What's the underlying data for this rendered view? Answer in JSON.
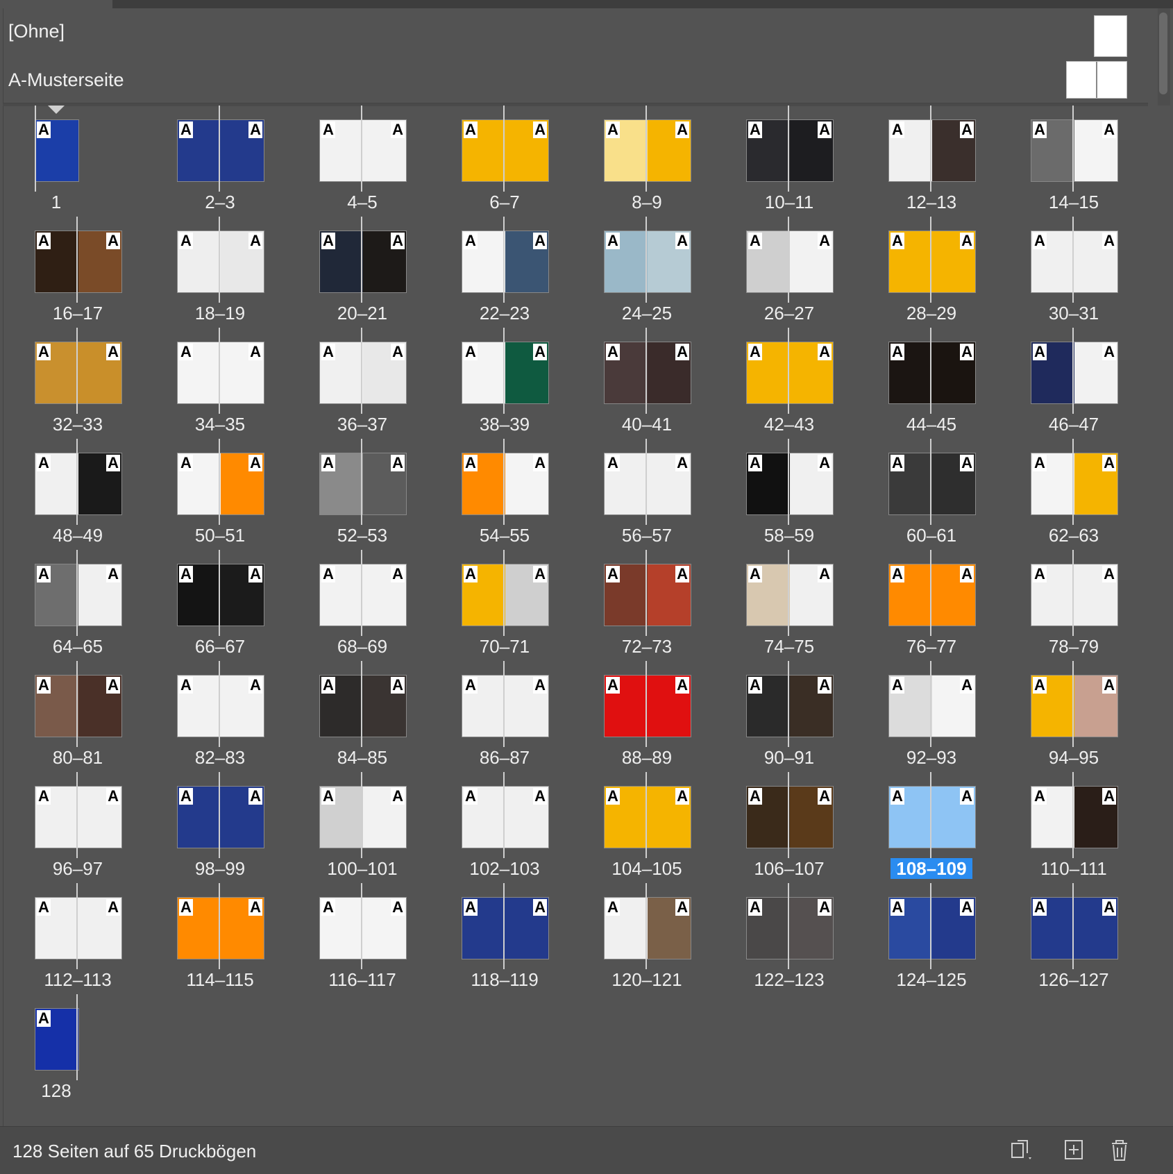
{
  "masters": {
    "none_label": "[Ohne]",
    "a_master_label": "A-Musterseite"
  },
  "spreads": [
    {
      "label": "1",
      "pages": 1,
      "colors": [
        "#1b3ea8"
      ],
      "marks": [
        "A"
      ]
    },
    {
      "label": "2–3",
      "pages": 2,
      "colors": [
        "#233a8c",
        "#233a8c"
      ],
      "marks": [
        "A",
        "A"
      ]
    },
    {
      "label": "4–5",
      "pages": 2,
      "colors": [
        "#f2f2f2",
        "#f2f2f2"
      ],
      "marks": [
        "A",
        "A"
      ]
    },
    {
      "label": "6–7",
      "pages": 2,
      "colors": [
        "#f5b400",
        "#f5b400"
      ],
      "marks": [
        "A",
        "A"
      ]
    },
    {
      "label": "8–9",
      "pages": 2,
      "colors": [
        "#f9e08a",
        "#f5b400"
      ],
      "marks": [
        "A",
        "A"
      ]
    },
    {
      "label": "10–11",
      "pages": 2,
      "colors": [
        "#2a2a2e",
        "#1d1d20"
      ],
      "marks": [
        "A",
        "A"
      ]
    },
    {
      "label": "12–13",
      "pages": 2,
      "colors": [
        "#f0f0f0",
        "#3a2f2c"
      ],
      "marks": [
        "A",
        "A"
      ]
    },
    {
      "label": "14–15",
      "pages": 2,
      "colors": [
        "#6b6b6b",
        "#f4f4f4"
      ],
      "marks": [
        "A",
        "A"
      ]
    },
    {
      "label": "16–17",
      "pages": 2,
      "colors": [
        "#2f1f14",
        "#7a4b28"
      ],
      "marks": [
        "A",
        "A"
      ]
    },
    {
      "label": "18–19",
      "pages": 2,
      "colors": [
        "#eeeeee",
        "#e8e8e8"
      ],
      "marks": [
        "A",
        "A"
      ]
    },
    {
      "label": "20–21",
      "pages": 2,
      "colors": [
        "#202838",
        "#1d1a18"
      ],
      "marks": [
        "A",
        "A"
      ]
    },
    {
      "label": "22–23",
      "pages": 2,
      "colors": [
        "#f4f4f4",
        "#3b5573"
      ],
      "marks": [
        "A",
        "A"
      ]
    },
    {
      "label": "24–25",
      "pages": 2,
      "colors": [
        "#9ab8c8",
        "#b6cbd4"
      ],
      "marks": [
        "A",
        "A"
      ]
    },
    {
      "label": "26–27",
      "pages": 2,
      "colors": [
        "#cfcfcf",
        "#f2f2f2"
      ],
      "marks": [
        "A",
        "A"
      ]
    },
    {
      "label": "28–29",
      "pages": 2,
      "colors": [
        "#f5b400",
        "#f5b400"
      ],
      "marks": [
        "A",
        "A"
      ]
    },
    {
      "label": "30–31",
      "pages": 2,
      "colors": [
        "#f0f0f0",
        "#f0f0f0"
      ],
      "marks": [
        "A",
        "A"
      ]
    },
    {
      "label": "32–33",
      "pages": 2,
      "colors": [
        "#c9902e",
        "#c98f2a"
      ],
      "marks": [
        "A",
        "A"
      ]
    },
    {
      "label": "34–35",
      "pages": 2,
      "colors": [
        "#f4f4f4",
        "#f4f4f4"
      ],
      "marks": [
        "A",
        "A"
      ]
    },
    {
      "label": "36–37",
      "pages": 2,
      "colors": [
        "#f0f0f0",
        "#e8e8e8"
      ],
      "marks": [
        "A",
        "A"
      ]
    },
    {
      "label": "38–39",
      "pages": 2,
      "colors": [
        "#f4f4f4",
        "#0f5a40"
      ],
      "marks": [
        "A",
        "A"
      ]
    },
    {
      "label": "40–41",
      "pages": 2,
      "colors": [
        "#4a3a3a",
        "#3a2b2a"
      ],
      "marks": [
        "A",
        "A"
      ]
    },
    {
      "label": "42–43",
      "pages": 2,
      "colors": [
        "#f5b400",
        "#f5b400"
      ],
      "marks": [
        "A",
        "A"
      ]
    },
    {
      "label": "44–45",
      "pages": 2,
      "colors": [
        "#1b1512",
        "#1a1410"
      ],
      "marks": [
        "A",
        "A"
      ]
    },
    {
      "label": "46–47",
      "pages": 2,
      "colors": [
        "#1f2a5c",
        "#f2f2f2"
      ],
      "marks": [
        "A",
        "A"
      ]
    },
    {
      "label": "48–49",
      "pages": 2,
      "colors": [
        "#f0f0f0",
        "#1a1a1a"
      ],
      "marks": [
        "A",
        "A"
      ]
    },
    {
      "label": "50–51",
      "pages": 2,
      "colors": [
        "#f4f4f4",
        "#ff8a00"
      ],
      "marks": [
        "A",
        "A"
      ]
    },
    {
      "label": "52–53",
      "pages": 2,
      "colors": [
        "#8a8a8a",
        "#5c5c5c"
      ],
      "marks": [
        "A",
        "A"
      ]
    },
    {
      "label": "54–55",
      "pages": 2,
      "colors": [
        "#ff8a00",
        "#f4f4f4"
      ],
      "marks": [
        "A",
        "A"
      ]
    },
    {
      "label": "56–57",
      "pages": 2,
      "colors": [
        "#f0f0f0",
        "#f0f0f0"
      ],
      "marks": [
        "A",
        "A"
      ]
    },
    {
      "label": "58–59",
      "pages": 2,
      "colors": [
        "#111111",
        "#f0f0f0"
      ],
      "marks": [
        "A",
        "A"
      ]
    },
    {
      "label": "60–61",
      "pages": 2,
      "colors": [
        "#3a3a3a",
        "#2e2e2e"
      ],
      "marks": [
        "A",
        "A"
      ]
    },
    {
      "label": "62–63",
      "pages": 2,
      "colors": [
        "#f4f4f4",
        "#f5b400"
      ],
      "marks": [
        "A",
        "A"
      ]
    },
    {
      "label": "64–65",
      "pages": 2,
      "colors": [
        "#6e6e6e",
        "#f0f0f0"
      ],
      "marks": [
        "A",
        "A"
      ]
    },
    {
      "label": "66–67",
      "pages": 2,
      "colors": [
        "#141414",
        "#1b1b1b"
      ],
      "marks": [
        "A",
        "A"
      ]
    },
    {
      "label": "68–69",
      "pages": 2,
      "colors": [
        "#f2f2f2",
        "#f2f2f2"
      ],
      "marks": [
        "A",
        "A"
      ]
    },
    {
      "label": "70–71",
      "pages": 2,
      "colors": [
        "#f5b400",
        "#cfcfcf"
      ],
      "marks": [
        "A",
        "A"
      ]
    },
    {
      "label": "72–73",
      "pages": 2,
      "colors": [
        "#7a3a2a",
        "#b5402a"
      ],
      "marks": [
        "A",
        "A"
      ]
    },
    {
      "label": "74–75",
      "pages": 2,
      "colors": [
        "#d8c8b0",
        "#f0f0f0"
      ],
      "marks": [
        "A",
        "A"
      ]
    },
    {
      "label": "76–77",
      "pages": 2,
      "colors": [
        "#ff8a00",
        "#ff8a00"
      ],
      "marks": [
        "A",
        "A"
      ]
    },
    {
      "label": "78–79",
      "pages": 2,
      "colors": [
        "#f0f0f0",
        "#f0f0f0"
      ],
      "marks": [
        "A",
        "A"
      ]
    },
    {
      "label": "80–81",
      "pages": 2,
      "colors": [
        "#7a5a4a",
        "#4a3028"
      ],
      "marks": [
        "A",
        "A"
      ]
    },
    {
      "label": "82–83",
      "pages": 2,
      "colors": [
        "#f2f2f2",
        "#f2f2f2"
      ],
      "marks": [
        "A",
        "A"
      ]
    },
    {
      "label": "84–85",
      "pages": 2,
      "colors": [
        "#2d2b2a",
        "#3a3432"
      ],
      "marks": [
        "A",
        "A"
      ]
    },
    {
      "label": "86–87",
      "pages": 2,
      "colors": [
        "#f0f0f0",
        "#f0f0f0"
      ],
      "marks": [
        "A",
        "A"
      ]
    },
    {
      "label": "88–89",
      "pages": 2,
      "colors": [
        "#e01010",
        "#e01010"
      ],
      "marks": [
        "A",
        "A"
      ]
    },
    {
      "label": "90–91",
      "pages": 2,
      "colors": [
        "#2a2a2a",
        "#3a2e25"
      ],
      "marks": [
        "A",
        "A"
      ]
    },
    {
      "label": "92–93",
      "pages": 2,
      "colors": [
        "#dcdcdc",
        "#f4f4f4"
      ],
      "marks": [
        "A",
        "A"
      ]
    },
    {
      "label": "94–95",
      "pages": 2,
      "colors": [
        "#f5b400",
        "#c8a090"
      ],
      "marks": [
        "A",
        "A"
      ]
    },
    {
      "label": "96–97",
      "pages": 2,
      "colors": [
        "#f0f0f0",
        "#f0f0f0"
      ],
      "marks": [
        "A",
        "A"
      ]
    },
    {
      "label": "98–99",
      "pages": 2,
      "colors": [
        "#233a8c",
        "#233a8c"
      ],
      "marks": [
        "A",
        "A"
      ]
    },
    {
      "label": "100–101",
      "pages": 2,
      "colors": [
        "#d0d0d0",
        "#f2f2f2"
      ],
      "marks": [
        "A",
        "A"
      ]
    },
    {
      "label": "102–103",
      "pages": 2,
      "colors": [
        "#f0f0f0",
        "#f0f0f0"
      ],
      "marks": [
        "A",
        "A"
      ]
    },
    {
      "label": "104–105",
      "pages": 2,
      "colors": [
        "#f5b400",
        "#f5b400"
      ],
      "marks": [
        "A",
        "A"
      ]
    },
    {
      "label": "106–107",
      "pages": 2,
      "colors": [
        "#3a2a1a",
        "#5a3a1a"
      ],
      "marks": [
        "A",
        "A"
      ]
    },
    {
      "label": "108–109",
      "pages": 2,
      "colors": [
        "#8ec4f4",
        "#8ec4f4"
      ],
      "marks": [
        "A",
        "A"
      ],
      "selected": true
    },
    {
      "label": "110–111",
      "pages": 2,
      "colors": [
        "#f2f2f2",
        "#2a1e18"
      ],
      "marks": [
        "A",
        "A"
      ]
    },
    {
      "label": "112–113",
      "pages": 2,
      "colors": [
        "#f0f0f0",
        "#f0f0f0"
      ],
      "marks": [
        "A",
        "A"
      ]
    },
    {
      "label": "114–115",
      "pages": 2,
      "colors": [
        "#ff8a00",
        "#ff8a00"
      ],
      "marks": [
        "A",
        "A"
      ]
    },
    {
      "label": "116–117",
      "pages": 2,
      "colors": [
        "#f4f4f4",
        "#f4f4f4"
      ],
      "marks": [
        "A",
        "A"
      ]
    },
    {
      "label": "118–119",
      "pages": 2,
      "colors": [
        "#233a8c",
        "#233a8c"
      ],
      "marks": [
        "A",
        "A"
      ]
    },
    {
      "label": "120–121",
      "pages": 2,
      "colors": [
        "#f0f0f0",
        "#7a6048"
      ],
      "marks": [
        "A",
        "A"
      ]
    },
    {
      "label": "122–123",
      "pages": 2,
      "colors": [
        "#4a4848",
        "#555050"
      ],
      "marks": [
        "A",
        "A"
      ]
    },
    {
      "label": "124–125",
      "pages": 2,
      "colors": [
        "#2a4aa0",
        "#233a8c"
      ],
      "marks": [
        "A",
        "A"
      ]
    },
    {
      "label": "126–127",
      "pages": 2,
      "colors": [
        "#233a8c",
        "#233a8c"
      ],
      "marks": [
        "A",
        "A"
      ]
    },
    {
      "label": "128",
      "pages": 1,
      "colors": [
        "#1530a8"
      ],
      "marks": [
        "A"
      ]
    }
  ],
  "footer": {
    "status": "128 Seiten auf 65 Druckbögen",
    "icons": [
      "edit-page-size-icon",
      "new-page-icon",
      "delete-page-icon"
    ]
  }
}
